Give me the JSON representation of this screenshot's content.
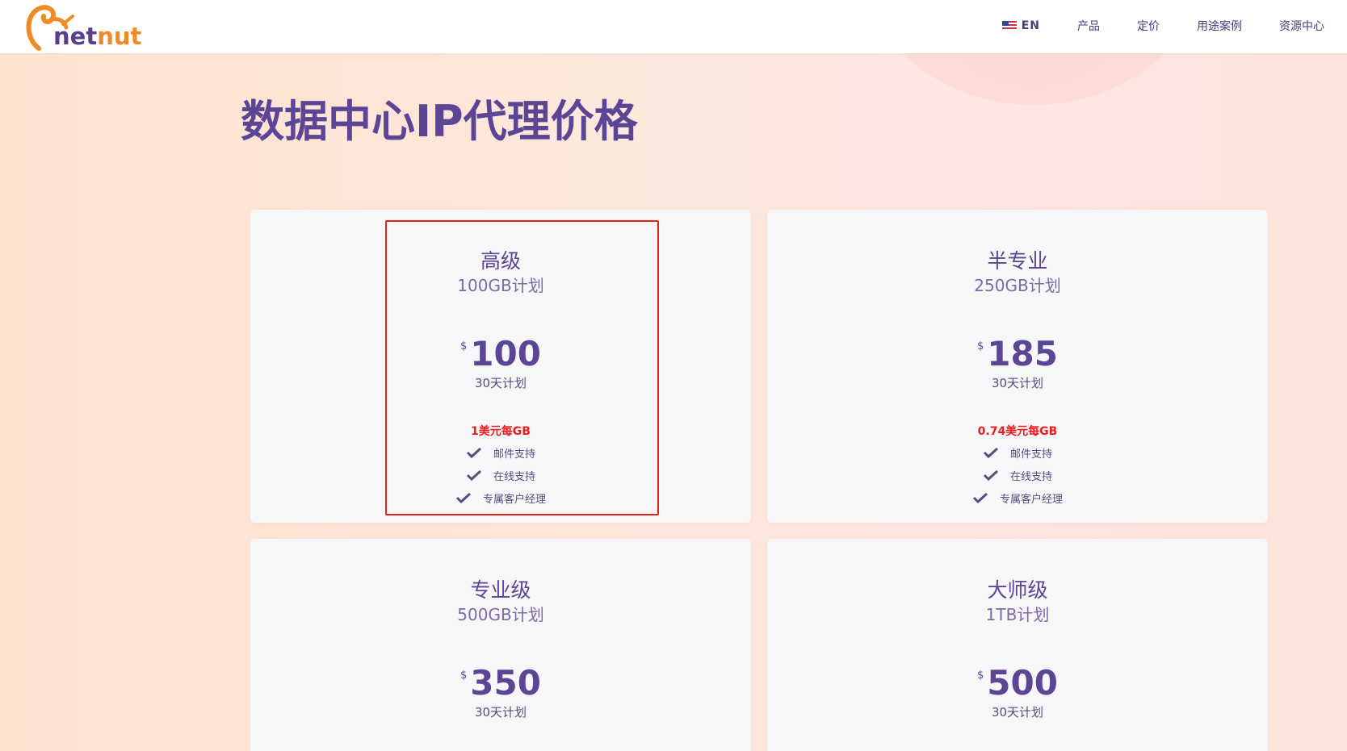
{
  "header": {
    "logo": {
      "prefix": "",
      "net": "net",
      "nut": "nut"
    },
    "nav": {
      "lang": "EN",
      "items": [
        "产品",
        "定价",
        "用途案例",
        "资源中心"
      ]
    }
  },
  "page_title": "数据中心IP代理价格",
  "colors": {
    "accent": "#5d4596",
    "brand_orange": "#f08a24",
    "highlight_red": "#e41f1f",
    "per_gb_red": "#ee1c1c"
  },
  "cards": [
    {
      "name": "高级",
      "size": "100GB计划",
      "currency": "$",
      "price": "100",
      "period": "30天计划",
      "per_gb": "1美元每GB",
      "features": [
        "邮件支持",
        "在线支持",
        "专属客户经理"
      ]
    },
    {
      "name": "半专业",
      "size": "250GB计划",
      "currency": "$",
      "price": "185",
      "period": "30天计划",
      "per_gb": "0.74美元每GB",
      "features": [
        "邮件支持",
        "在线支持",
        "专属客户经理"
      ]
    },
    {
      "name": "专业级",
      "size": "500GB计划",
      "currency": "$",
      "price": "350",
      "period": "30天计划"
    },
    {
      "name": "大师级",
      "size": "1TB计划",
      "currency": "$",
      "price": "500",
      "period": "30天计划"
    }
  ]
}
